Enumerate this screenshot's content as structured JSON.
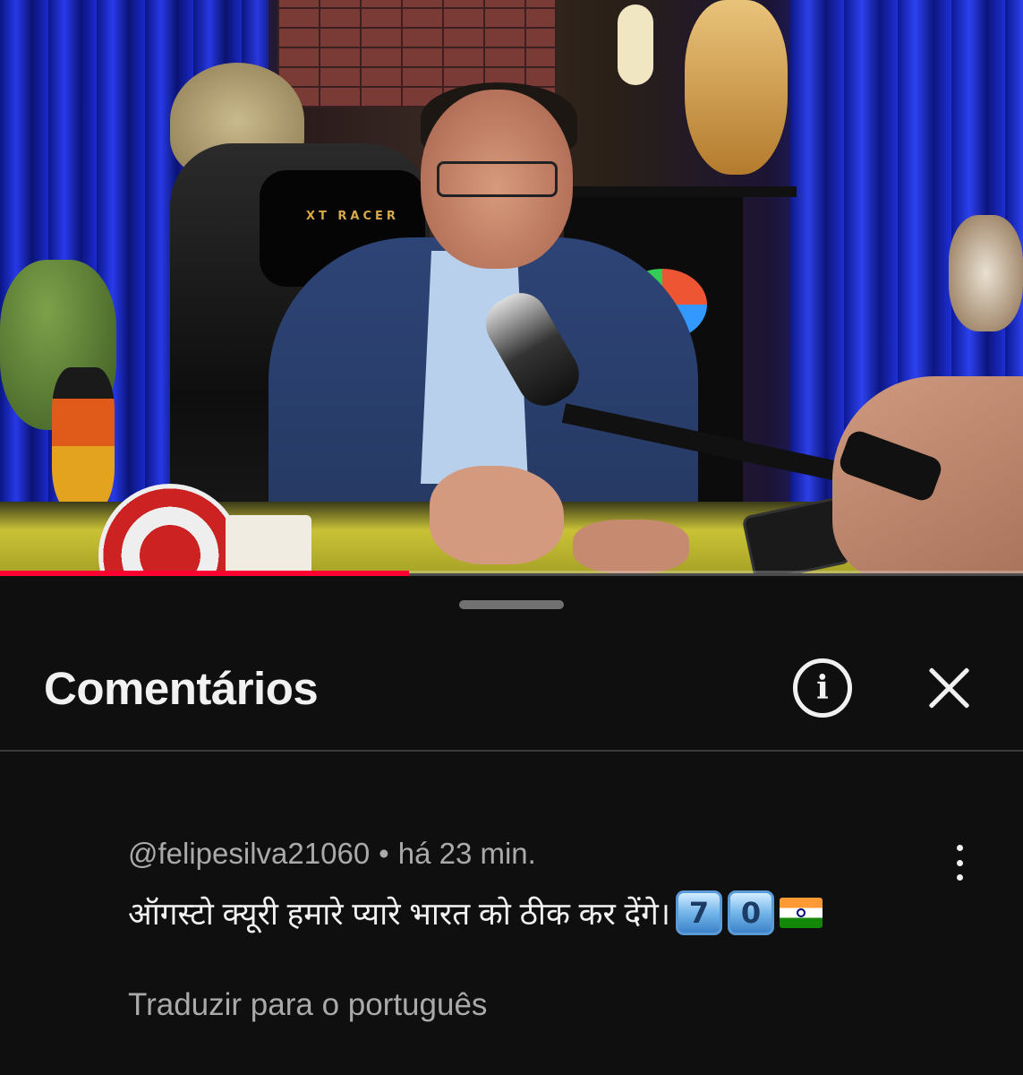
{
  "player": {
    "progress_fraction": 0.4,
    "chair_brand": "XT RACER",
    "accent_color": "#ff0033"
  },
  "sheet": {
    "title": "Comentários",
    "info_icon": "info-circle-icon",
    "close_icon": "close-icon"
  },
  "comment": {
    "author": "@felipesilva21060",
    "separator": "•",
    "time": "há 23 min.",
    "text": "ऑगस्टो क्यूरी हमारे प्यारे भारत को ठीक कर देंगे।",
    "keycap_digits": [
      "7",
      "0"
    ],
    "flag_emoji": "india-flag",
    "translate_label": "Traduzir para o português",
    "more_icon": "more-vertical-icon"
  },
  "colors": {
    "background": "#0f0f0f",
    "text_primary": "#f1f1f1",
    "text_secondary": "#aaaaaa"
  }
}
